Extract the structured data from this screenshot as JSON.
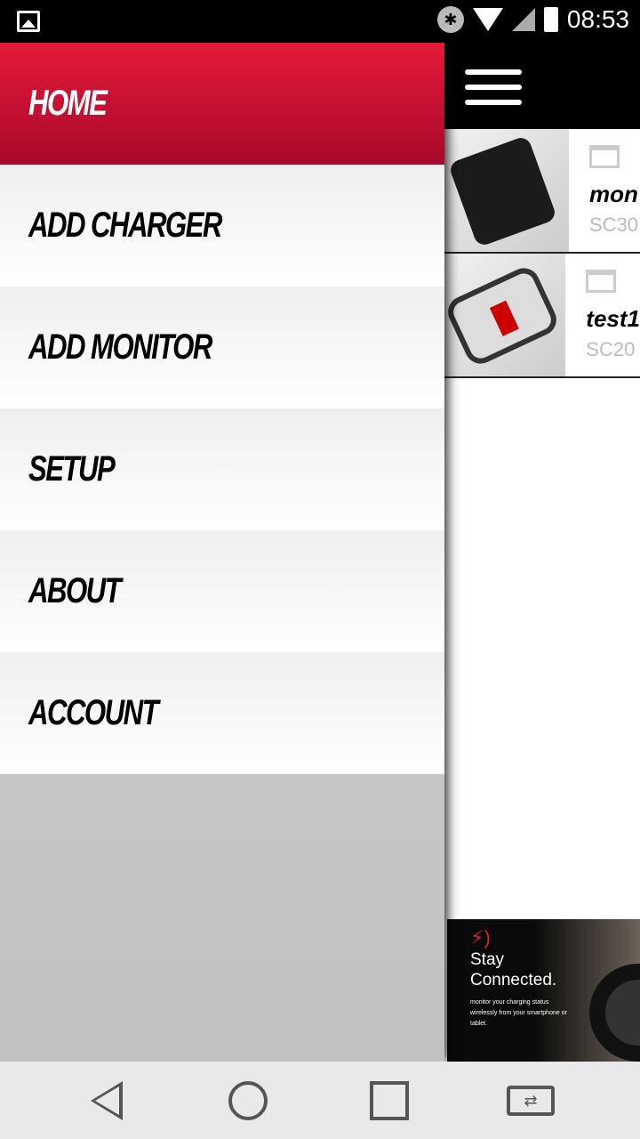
{
  "status_bar": {
    "time": "08:53",
    "icons": [
      "image-icon",
      "bluetooth-icon",
      "wifi-icon",
      "signal-icon",
      "battery-icon"
    ]
  },
  "drawer": {
    "items": [
      {
        "label": "HOME",
        "active": true
      },
      {
        "label": "ADD CHARGER"
      },
      {
        "label": "ADD MONITOR"
      },
      {
        "label": "SETUP"
      },
      {
        "label": "ABOUT"
      },
      {
        "label": "ACCOUNT"
      }
    ]
  },
  "devices": [
    {
      "name": "mon",
      "model": "SC30"
    },
    {
      "name": "test1",
      "model": "SC20"
    }
  ],
  "banner": {
    "headline_1": "Stay",
    "headline_2": "Connected.",
    "subtext": "monitor your charging status wirelessly from your smartphone or tablet."
  },
  "colors": {
    "accent": "#d8143a"
  }
}
